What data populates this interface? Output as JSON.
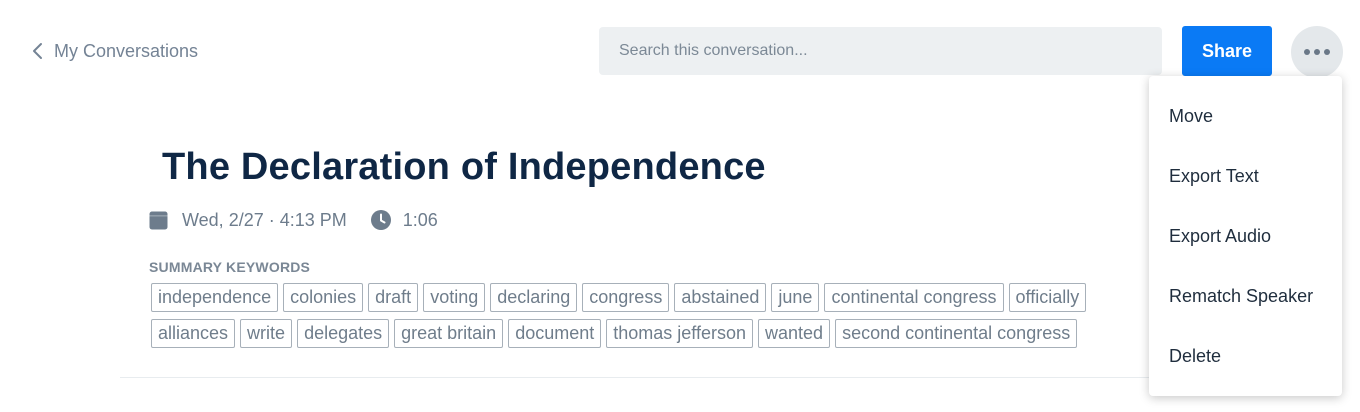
{
  "header": {
    "back_label": "My Conversations",
    "search_placeholder": "Search this conversation...",
    "share_label": "Share"
  },
  "conversation": {
    "title": "The Declaration of Independence",
    "date": "Wed, 2/27 · 4:13 PM",
    "duration": "1:06"
  },
  "keywords": {
    "heading": "SUMMARY KEYWORDS",
    "row1": [
      "independence",
      "colonies",
      "draft",
      "voting",
      "declaring",
      "congress",
      "abstained",
      "june",
      "continental congress",
      "officially"
    ],
    "row2": [
      "alliances",
      "write",
      "delegates",
      "great britain",
      "document",
      "thomas jefferson",
      "wanted",
      "second continental congress"
    ]
  },
  "menu": {
    "items": [
      "Move",
      "Export Text",
      "Export Audio",
      "Rematch Speaker",
      "Delete"
    ]
  },
  "icons": {
    "back": "chevron-left-icon",
    "more": "more-horizontal-icon",
    "calendar": "calendar-icon",
    "duration": "clock-icon"
  },
  "colors": {
    "accent": "#0a7af5",
    "title": "#0f2745",
    "muted_text": "#748395",
    "search_bg": "#edf0f2"
  }
}
